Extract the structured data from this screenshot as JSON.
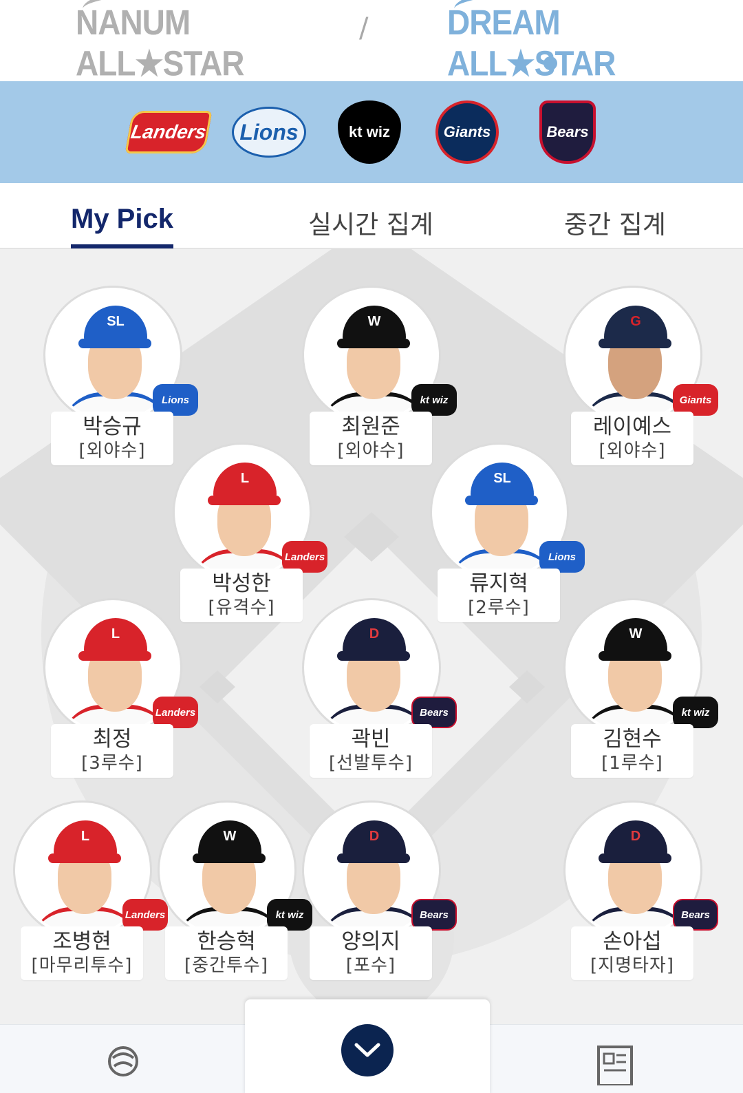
{
  "leagues": [
    {
      "name": "NANUM ALL★STAR",
      "selected": false,
      "color": "#b0b0b0"
    },
    {
      "name": "DREAM ALL★STAR",
      "selected": true,
      "color": "#7fb1db"
    }
  ],
  "divider": "/",
  "teams": [
    {
      "id": "landers",
      "label": "Landers"
    },
    {
      "id": "lions",
      "label": "Lions"
    },
    {
      "id": "kt",
      "label": "kt wiz"
    },
    {
      "id": "giants",
      "label": "Giants"
    },
    {
      "id": "bears",
      "label": "Bears"
    }
  ],
  "tabs": [
    {
      "label": "My Pick",
      "active": true
    },
    {
      "label": "실시간 집계",
      "active": false
    },
    {
      "label": "중간 집계",
      "active": false
    }
  ],
  "players": [
    {
      "name": "박승규",
      "position": "[외야수]",
      "team": "Lions",
      "cap_mark": "SL"
    },
    {
      "name": "최원준",
      "position": "[외야수]",
      "team": "kt wiz",
      "cap_mark": "W"
    },
    {
      "name": "레이예스",
      "position": "[외야수]",
      "team": "Giants",
      "cap_mark": "G"
    },
    {
      "name": "박성한",
      "position": "[유격수]",
      "team": "Landers",
      "cap_mark": "L"
    },
    {
      "name": "류지혁",
      "position": "[2루수]",
      "team": "Lions",
      "cap_mark": "SL"
    },
    {
      "name": "최정",
      "position": "[3루수]",
      "team": "Landers",
      "cap_mark": "L"
    },
    {
      "name": "곽빈",
      "position": "[선발투수]",
      "team": "Bears",
      "cap_mark": "D"
    },
    {
      "name": "김현수",
      "position": "[1루수]",
      "team": "kt wiz",
      "cap_mark": "W"
    },
    {
      "name": "조병현",
      "position": "[마무리투수]",
      "team": "Landers",
      "cap_mark": "L"
    },
    {
      "name": "한승혁",
      "position": "[중간투수]",
      "team": "kt wiz",
      "cap_mark": "W"
    },
    {
      "name": "양의지",
      "position": "[포수]",
      "team": "Bears",
      "cap_mark": "D"
    },
    {
      "name": "손아섭",
      "position": "[지명타자]",
      "team": "Bears",
      "cap_mark": "D"
    }
  ],
  "colors": {
    "accent": "#13276b",
    "band": "#a3c9e8",
    "expand_button": "#0b2450"
  },
  "icons": {
    "home": "kbo-logo-icon",
    "expand": "chevron-down-icon",
    "news": "newspaper-icon"
  }
}
